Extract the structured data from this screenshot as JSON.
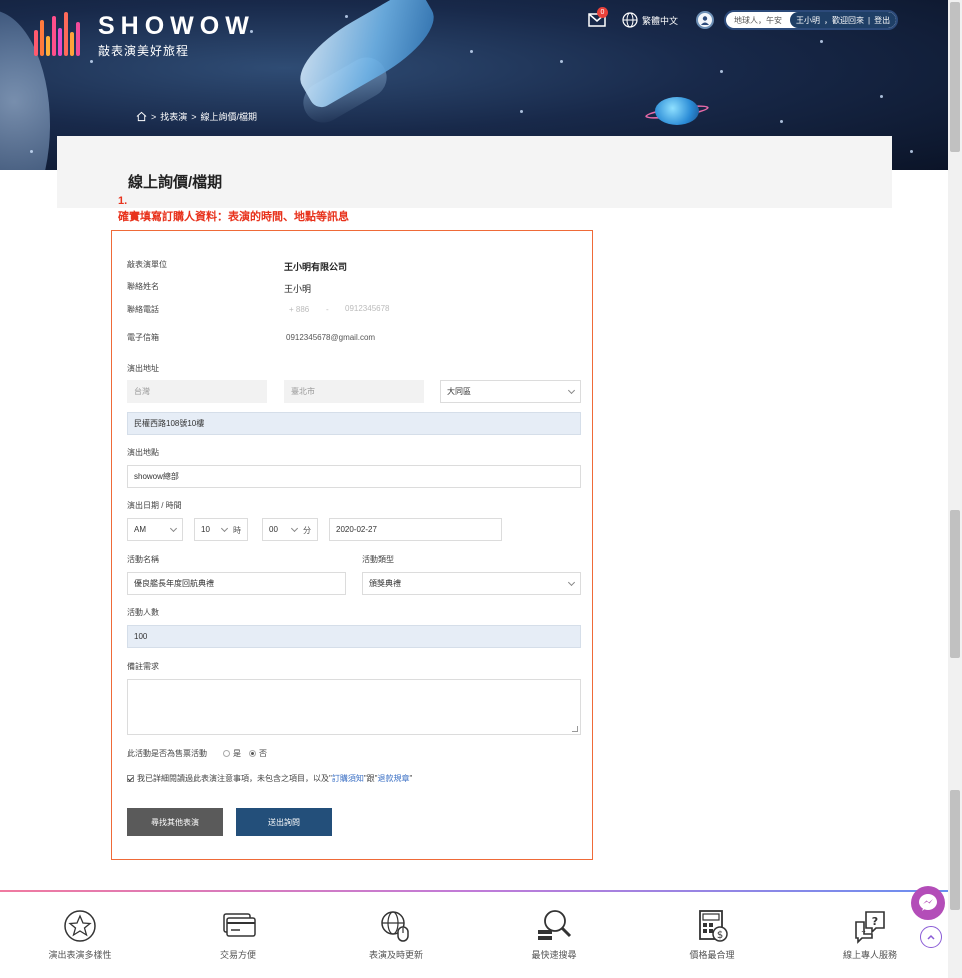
{
  "header": {
    "brand": "SHOWOW",
    "tagline": "敲表演美好旅程",
    "breadcrumb": [
      "找表演",
      "線上詢價/檔期"
    ],
    "mail_badge": "0",
    "language": "繁體中文",
    "greeting": "地球人，午安",
    "user_name": "王小明",
    "welcome": "，歡迎回來",
    "logout": "登出"
  },
  "page": {
    "title": "線上詢價/檔期",
    "note_number": "1.",
    "note": "確實填寫訂購人資料：表演的時間、地點等訊息"
  },
  "form": {
    "unit_label": "敲表演單位",
    "unit_value": "王小明有限公司",
    "contact_label": "聯絡姓名",
    "contact_value": "王小明",
    "phone_label": "聯絡電話",
    "phone_country": "+ 886",
    "phone_sep": "-",
    "phone_value": "0912345678",
    "email_label": "電子信箱",
    "email_value": "0912345678@gmail.com",
    "address_label": "演出地址",
    "country": "台灣",
    "city": "臺北市",
    "district": "大同區",
    "street": "民權西路108號10樓",
    "venue_label": "演出地點",
    "venue": "showow總部",
    "datetime_label": "演出日期 / 時間",
    "ampm": "AM",
    "hour": "10",
    "hour_unit": "時",
    "minute": "00",
    "minute_unit": "分",
    "date": "2020-02-27",
    "event_name_label": "活動名稱",
    "event_name": "優良艦長年度回航典禮",
    "event_type_label": "活動類型",
    "event_type": "頒獎典禮",
    "attendees_label": "活動人數",
    "attendees": "100",
    "remarks_label": "備註需求",
    "ticketing_label": "此活動是否為售票活動",
    "yes": "是",
    "no": "否",
    "agree_text": "我已詳細閱讀過此表演注意事項，未包含之項目，以及\"",
    "agree_link1": "訂購須知",
    "agree_mid": "\"跟\"",
    "agree_link2": "退款規章",
    "agree_end": "\"",
    "btn_find": "尋找其他表演",
    "btn_submit": "送出詢問"
  },
  "footer": {
    "features": [
      {
        "label": "演出表演多樣性",
        "icon": "star-badge-icon"
      },
      {
        "label": "交易方便",
        "icon": "credit-card-icon"
      },
      {
        "label": "表演及時更新",
        "icon": "globe-mouse-icon"
      },
      {
        "label": "最快速搜尋",
        "icon": "search-magnifier-icon"
      },
      {
        "label": "價格最合理",
        "icon": "calculator-icon"
      },
      {
        "label": "線上專人服務",
        "icon": "chat-question-icon"
      }
    ]
  },
  "colors": {
    "accent_red": "#e8321c",
    "form_border": "#ef6a38",
    "submit_blue": "#234f7a",
    "link_blue": "#3a6fc4"
  }
}
